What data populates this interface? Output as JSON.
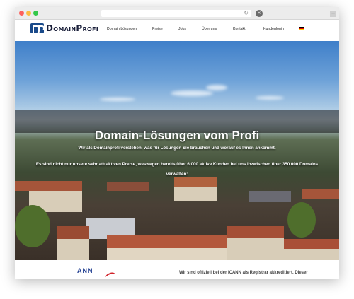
{
  "browser": {
    "icons": [
      "close-dot",
      "minimize-dot",
      "maximize-dot",
      "reload-icon",
      "stop-icon",
      "new-tab-icon"
    ],
    "colors": {
      "close": "#fc605c",
      "minimize": "#fdbc40",
      "maximize": "#34c84a"
    }
  },
  "header": {
    "logo_text": "DomainProfi",
    "nav": [
      "Domain Lösungen",
      "Preise",
      "Jobs",
      "Über uns",
      "Kontakt",
      "Kundenlogin"
    ],
    "language_flag": "flag-icon-de",
    "brand_color": "#1a4a8a"
  },
  "hero": {
    "title": "Domain-Lösungen vom Profi",
    "subtitle": "Wir als Domainprofi verstehen, was für Lösungen Sie brauchen und worauf es Ihnen ankommt.",
    "text": "Es sind nicht nur unsere sehr attraktiven Preise, weswegen bereits über 6.000 aktive Kunden bei uns inzwischen über 350.000 Domains verwalten:"
  },
  "lower": {
    "icann_logo": "ANN",
    "icann_text": "Wir sind offiziell bei der ICANN als Registrar akkreditiert. Dieser"
  }
}
